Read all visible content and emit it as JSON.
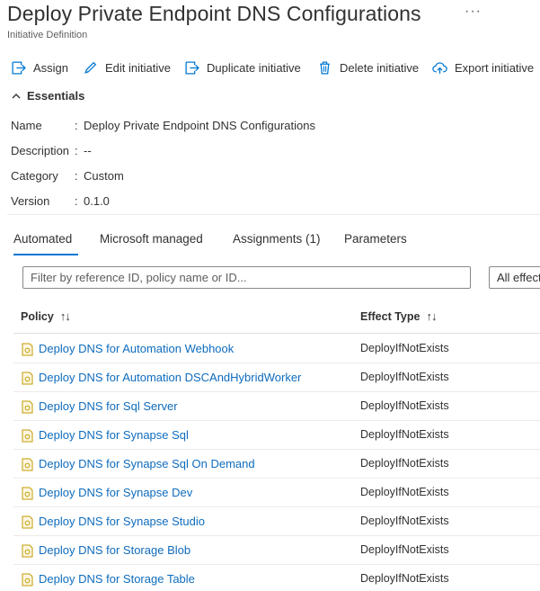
{
  "header": {
    "title": "Deploy Private Endpoint DNS Configurations",
    "more": "···",
    "subtitle": "Initiative Definition"
  },
  "toolbar": {
    "assign": "Assign",
    "edit": "Edit initiative",
    "duplicate": "Duplicate initiative",
    "delete": "Delete initiative",
    "export": "Export initiative"
  },
  "essentials": {
    "title": "Essentials",
    "rows": [
      {
        "label": "Name",
        "value": "Deploy Private Endpoint DNS Configurations"
      },
      {
        "label": "Description",
        "value": "--"
      },
      {
        "label": "Category",
        "value": "Custom"
      },
      {
        "label": "Version",
        "value": "0.1.0"
      }
    ]
  },
  "tabs": [
    "Automated",
    "Microsoft managed",
    "Assignments (1)",
    "Parameters"
  ],
  "filter": {
    "placeholder": "Filter by reference ID, policy name or ID...",
    "effect_dropdown": "All effect"
  },
  "table": {
    "columns": {
      "policy": "Policy",
      "effect": "Effect Type",
      "sort": "↑↓"
    },
    "rows": [
      {
        "policy": "Deploy DNS for Automation Webhook",
        "effect": "DeployIfNotExists"
      },
      {
        "policy": "Deploy DNS for Automation DSCAndHybridWorker",
        "effect": "DeployIfNotExists"
      },
      {
        "policy": "Deploy DNS for Sql Server",
        "effect": "DeployIfNotExists"
      },
      {
        "policy": "Deploy DNS for Synapse Sql",
        "effect": "DeployIfNotExists"
      },
      {
        "policy": "Deploy DNS for Synapse Sql On Demand",
        "effect": "DeployIfNotExists"
      },
      {
        "policy": "Deploy DNS for Synapse Dev",
        "effect": "DeployIfNotExists"
      },
      {
        "policy": "Deploy DNS for Synapse Studio",
        "effect": "DeployIfNotExists"
      },
      {
        "policy": "Deploy DNS for Storage Blob",
        "effect": "DeployIfNotExists"
      },
      {
        "policy": "Deploy DNS for Storage Table",
        "effect": "DeployIfNotExists"
      }
    ]
  },
  "colors": {
    "accent": "#0078d4",
    "link": "#0f6cbd",
    "text": "#323130"
  }
}
